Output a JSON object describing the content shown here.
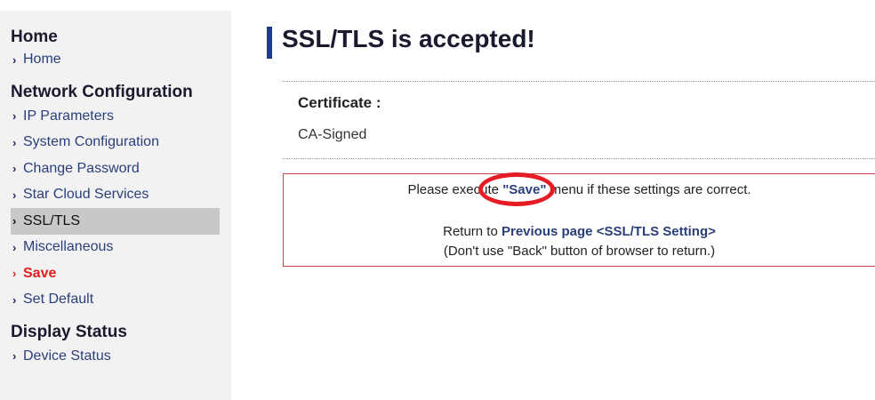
{
  "sidebar": {
    "home_title": "Home",
    "home_items": [
      {
        "label": "Home"
      }
    ],
    "network_title": "Network Configuration",
    "network_items": [
      {
        "label": "IP Parameters"
      },
      {
        "label": "System Configuration"
      },
      {
        "label": "Change Password"
      },
      {
        "label": "Star Cloud Services"
      },
      {
        "label": "SSL/TLS",
        "active": true
      },
      {
        "label": "Miscellaneous"
      },
      {
        "label": "Save",
        "highlighted": true
      },
      {
        "label": "Set Default"
      }
    ],
    "display_title": "Display Status",
    "display_items": [
      {
        "label": "Device Status"
      }
    ]
  },
  "main": {
    "title": "SSL/TLS is accepted!",
    "certificate_label": "Certificate :",
    "certificate_value": "CA-Signed",
    "message": {
      "line1_prefix": "Please execute ",
      "line1_link": "\"Save\"",
      "line1_suffix": " menu if these settings are correct.",
      "line2_prefix": "Return to ",
      "line2_link": "Previous page <SSL/TLS Setting>",
      "line3": "(Don't use \"Back\" button of browser to return.)"
    }
  },
  "colors": {
    "accent": "#1f3b8a",
    "link": "#2a3f7a",
    "save_red": "#e0201e",
    "annotation_ring": "#e51c23",
    "box_border": "#c94444"
  },
  "icons": {
    "menu_bullet": "chevron-right-icon"
  }
}
